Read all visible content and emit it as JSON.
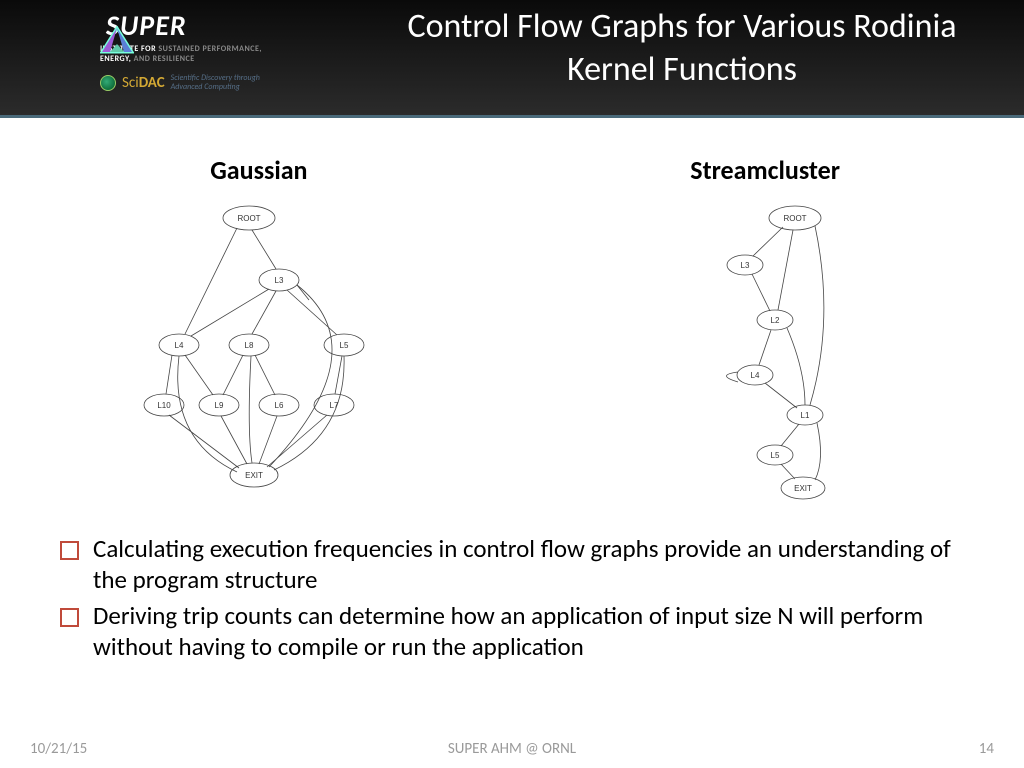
{
  "header": {
    "logo_text": "SUPER",
    "institute_line1_white": "INSTITUTE FOR",
    "institute_line1_grey": " SUSTAINED PERFORMANCE,",
    "institute_line2_white": "ENERGY,",
    "institute_line2_grey": " AND RESILIENCE",
    "scidac_sci": "Sci",
    "scidac_dac": "DAC",
    "scidac_tag1": "Scientific Discovery through",
    "scidac_tag2": "Advanced Computing",
    "title": "Control Flow Graphs for Various Rodinia Kernel Functions"
  },
  "diagrams": {
    "left": {
      "label": "Gaussian",
      "nodes": [
        "ROOT",
        "L3",
        "L4",
        "L8",
        "L5",
        "L10",
        "L9",
        "L6",
        "L7",
        "EXIT"
      ],
      "edges": [
        [
          "ROOT",
          "L3"
        ],
        [
          "ROOT",
          "L4"
        ],
        [
          "L3",
          "L4"
        ],
        [
          "L3",
          "L8"
        ],
        [
          "L3",
          "L5"
        ],
        [
          "L3",
          "EXIT"
        ],
        [
          "L4",
          "L10"
        ],
        [
          "L4",
          "L9"
        ],
        [
          "L8",
          "L9"
        ],
        [
          "L8",
          "L6"
        ],
        [
          "L5",
          "L7"
        ],
        [
          "L10",
          "EXIT"
        ],
        [
          "L9",
          "EXIT"
        ],
        [
          "L6",
          "EXIT"
        ],
        [
          "L7",
          "EXIT"
        ],
        [
          "L4",
          "EXIT"
        ],
        [
          "L8",
          "EXIT"
        ],
        [
          "L5",
          "EXIT"
        ]
      ]
    },
    "right": {
      "label": "Streamcluster",
      "nodes": [
        "ROOT",
        "L3",
        "L2",
        "L4",
        "L1",
        "L5",
        "EXIT"
      ],
      "edges": [
        [
          "ROOT",
          "L3"
        ],
        [
          "ROOT",
          "L2"
        ],
        [
          "ROOT",
          "L1"
        ],
        [
          "L3",
          "L2"
        ],
        [
          "L2",
          "L4"
        ],
        [
          "L2",
          "L1"
        ],
        [
          "L4",
          "L4"
        ],
        [
          "L4",
          "L1"
        ],
        [
          "L1",
          "L5"
        ],
        [
          "L1",
          "EXIT"
        ],
        [
          "L5",
          "EXIT"
        ]
      ]
    }
  },
  "bullets": [
    "Calculating execution frequencies in control flow graphs provide an understanding of the program structure",
    "Deriving trip counts can determine how an application of input size N will perform without having to compile or run the application"
  ],
  "footer": {
    "date": "10/21/15",
    "venue": "SUPER AHM @ ORNL",
    "page": "14"
  }
}
